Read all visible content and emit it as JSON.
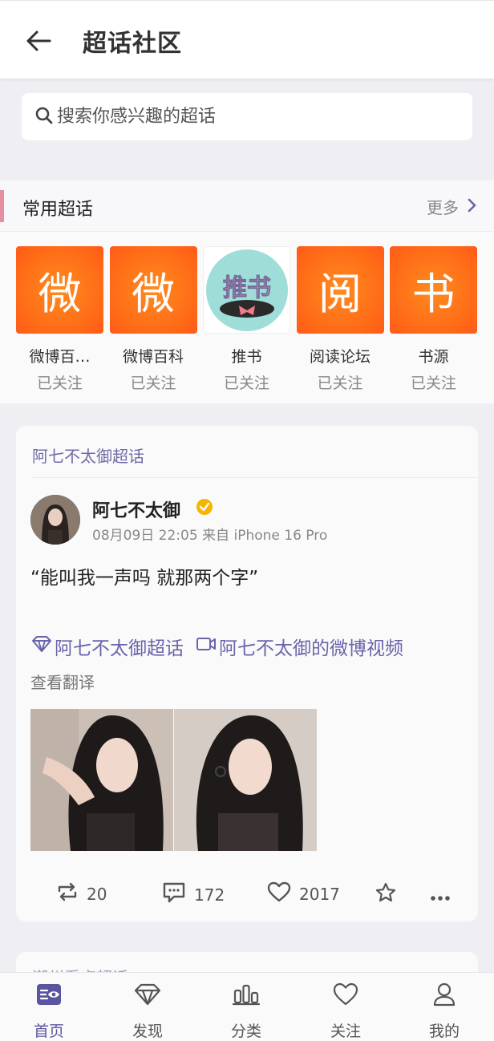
{
  "header": {
    "title": "超话社区",
    "back_icon": "arrow-left-icon"
  },
  "search": {
    "placeholder": "搜索你感兴趣的超话",
    "icon": "search-icon"
  },
  "frequent": {
    "title": "常用超话",
    "more_label": "更多",
    "items": [
      {
        "glyph": "微",
        "name": "微博百…",
        "status": "已关注"
      },
      {
        "glyph": "微",
        "name": "微博百科",
        "status": "已关注"
      },
      {
        "glyph": "推书",
        "name": "推书",
        "status": "已关注"
      },
      {
        "glyph": "阅",
        "name": "阅读论坛",
        "status": "已关注"
      },
      {
        "glyph": "书",
        "name": "书源",
        "status": "已关注"
      }
    ]
  },
  "post": {
    "source": "阿七不太御超话",
    "author": "阿七不太御",
    "meta": "08月09日 22:05  来自 iPhone 16 Pro",
    "content": "“能叫我一声吗 就那两个字”",
    "link_supertopic": "阿七不太御超话",
    "link_video": "阿七不太御的微博视频",
    "translate": "查看翻译",
    "reposts": "20",
    "comments": "172",
    "likes": "2017"
  },
  "next_card": {
    "source": "潮州看点超话"
  },
  "tabbar": {
    "items": [
      {
        "label": "首页",
        "icon": "home-eye-icon",
        "active": true
      },
      {
        "label": "发现",
        "icon": "diamond-icon"
      },
      {
        "label": "分类",
        "icon": "bars-icon"
      },
      {
        "label": "关注",
        "icon": "heart-icon"
      },
      {
        "label": "我的",
        "icon": "person-icon"
      }
    ]
  },
  "colors": {
    "accent": "#6a64ab",
    "tile_orange": "#ff6a17",
    "marker_pink": "#e58fa0"
  }
}
